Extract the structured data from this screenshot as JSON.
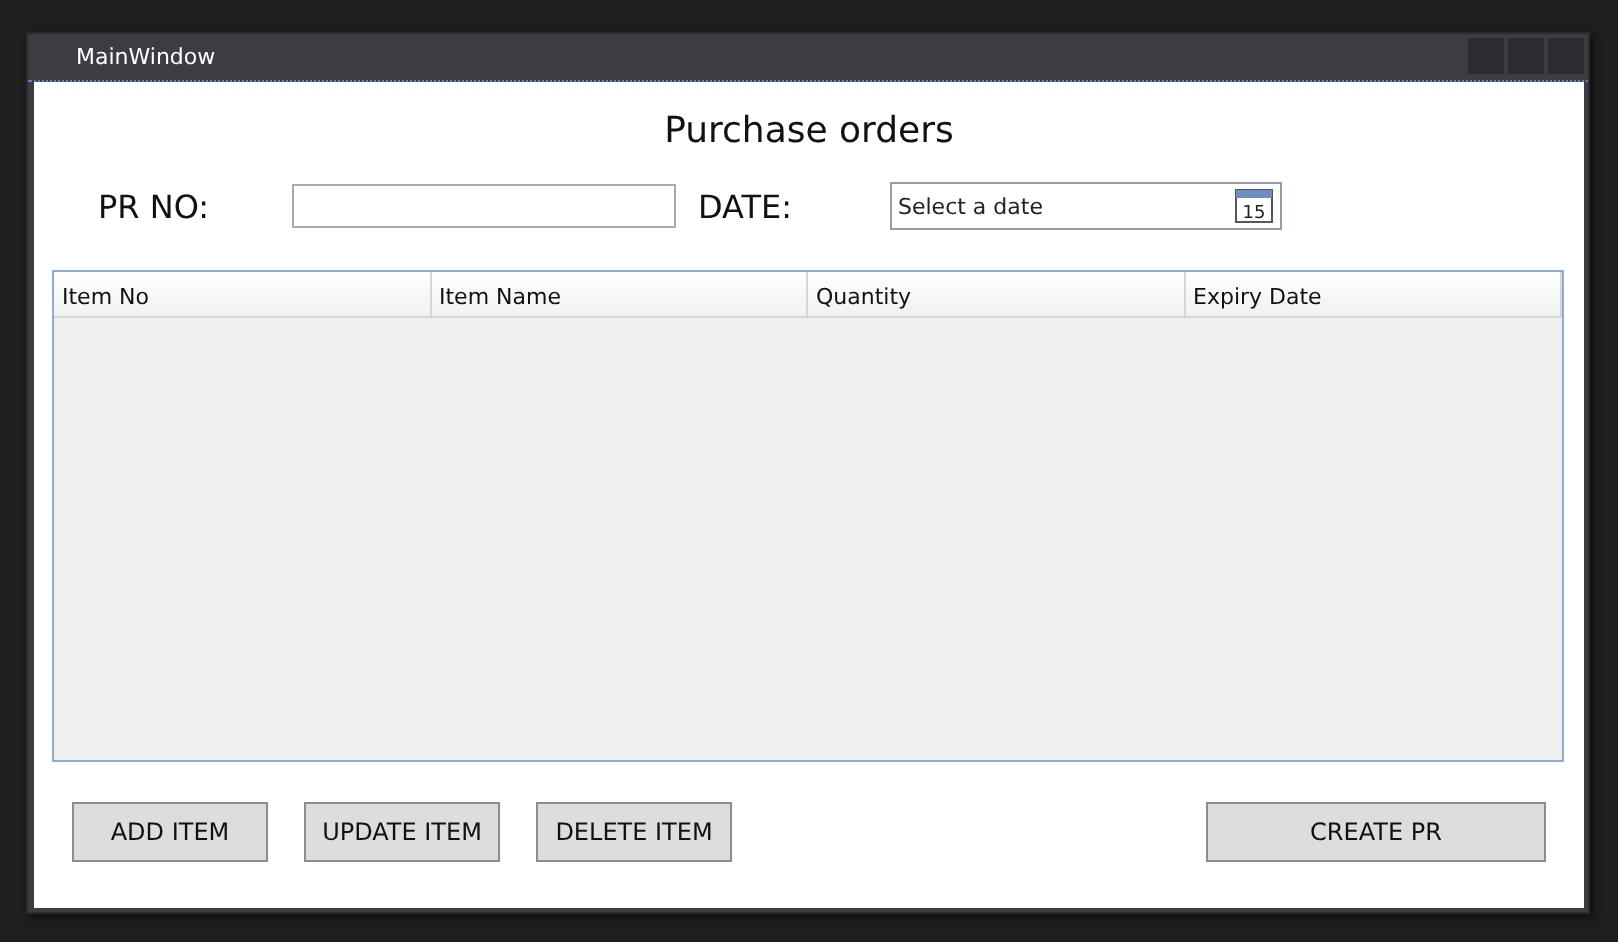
{
  "window": {
    "title": "MainWindow"
  },
  "heading": "Purchase orders",
  "form": {
    "pr_label": "PR NO:",
    "date_label": "DATE:",
    "date_placeholder": "Select a date",
    "calendar_day": "15"
  },
  "table": {
    "columns": [
      "Item No",
      "Item Name",
      "Quantity",
      "Expiry Date"
    ]
  },
  "buttons": [
    {
      "label": "ADD ITEM",
      "kind": "left"
    },
    {
      "label": "UPDATE ITEM",
      "kind": "left"
    },
    {
      "label": "DELETE ITEM",
      "kind": "left"
    },
    {
      "label": "CREATE PR",
      "kind": "right"
    }
  ]
}
